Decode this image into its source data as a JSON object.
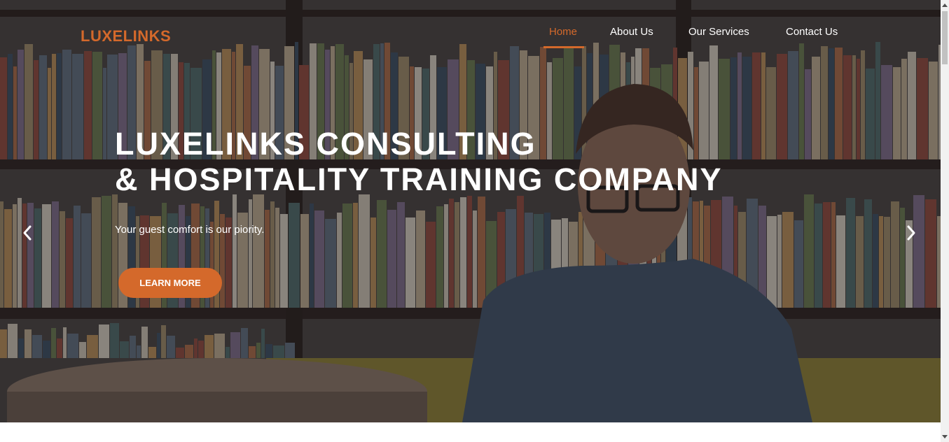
{
  "colors": {
    "accent": "#d4692b",
    "text_light": "#ffffff"
  },
  "navbar": {
    "brand": "LUXELINKS",
    "links": [
      {
        "label": "Home",
        "active": true
      },
      {
        "label": "About Us",
        "active": false
      },
      {
        "label": "Our Services",
        "active": false
      },
      {
        "label": "Contact Us",
        "active": false
      }
    ]
  },
  "hero": {
    "title_line1": "LUXELINKS CONSULTING",
    "title_line2": "& HOSPITALITY TRAINING COMPANY",
    "subtitle": "Your guest comfort is our piority.",
    "cta_label": "LEARN MORE",
    "prev_icon": "chevron-left-icon",
    "next_icon": "chevron-right-icon"
  }
}
